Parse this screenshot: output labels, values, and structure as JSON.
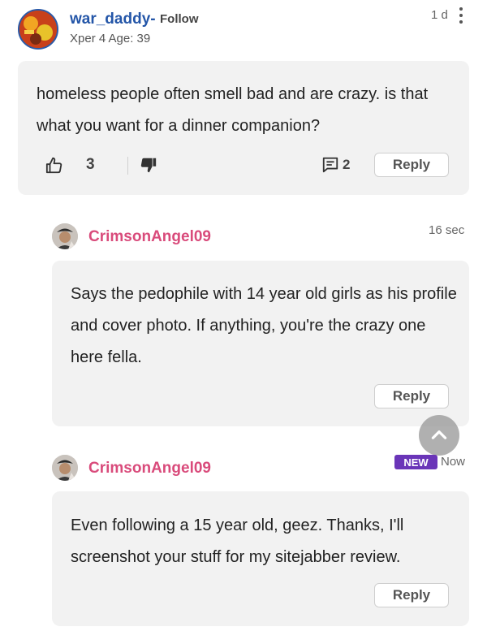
{
  "main_comment": {
    "username": "war_daddy-",
    "follow_label": "Follow",
    "meta": "Xper 4 Age: 39",
    "time": "1 d",
    "text": "homeless people often smell bad and are crazy. is that what you want for a dinner companion?",
    "upvotes": "3",
    "reply_count": "2",
    "reply_label": "Reply"
  },
  "replies": [
    {
      "username": "CrimsonAngel09",
      "time": "16 sec",
      "text": "Says the pedophile with 14 year old girls as his profile and cover photo. If anything, you're the crazy one here fella.",
      "reply_label": "Reply"
    },
    {
      "username": "CrimsonAngel09",
      "badge": "NEW",
      "time": "Now",
      "text": "Even following a 15 year old, geez. Thanks, I'll screenshot your stuff for my sitejabber review.",
      "reply_label": "Reply"
    }
  ],
  "colors": {
    "username_blue": "#2456a8",
    "reply_user_pink": "#d94b7b",
    "badge_purple": "#6a35b8",
    "card_bg": "#f2f2f2"
  },
  "icons": {
    "upvote": "thumbs-up-icon",
    "downvote": "thumbs-down-icon",
    "comments": "comment-icon",
    "menu": "more-vertical-icon",
    "scroll": "chevron-up-icon"
  }
}
